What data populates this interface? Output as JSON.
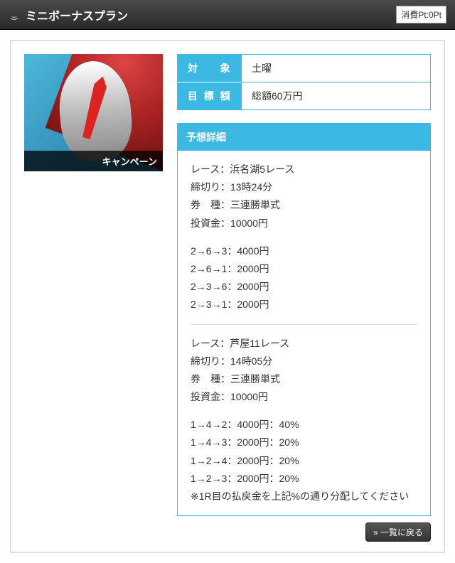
{
  "header": {
    "title": "ミニボーナスプラン",
    "pt_label": "消費Pt:0Pt"
  },
  "thumb": {
    "badge": "キャンペーン"
  },
  "info": {
    "target_label": "対　象",
    "target_value": "土曜",
    "goal_label": "目標額",
    "goal_value": "総額60万円"
  },
  "detail": {
    "heading": "予想詳細",
    "race1": {
      "lines": [
        "レース：浜名湖5レース",
        "締切り：13時24分",
        "券　種：三連勝単式",
        "投資金：10000円"
      ],
      "bets": [
        "2→6→3：4000円",
        "2→6→1：2000円",
        "2→3→6：2000円",
        "2→3→1：2000円"
      ]
    },
    "race2": {
      "lines": [
        "レース：芦屋11レース",
        "締切り：14時05分",
        "券　種：三連勝単式",
        "投資金：10000円"
      ],
      "bets": [
        "1→4→2：4000円：40%",
        "1→4→3：2000円：20%",
        "1→2→4：2000円：20%",
        "1→2→3：2000円：20%",
        "※1R目の払戻金を上記%の通り分配してください"
      ]
    }
  },
  "footer": {
    "back": "» 一覧に戻る"
  }
}
